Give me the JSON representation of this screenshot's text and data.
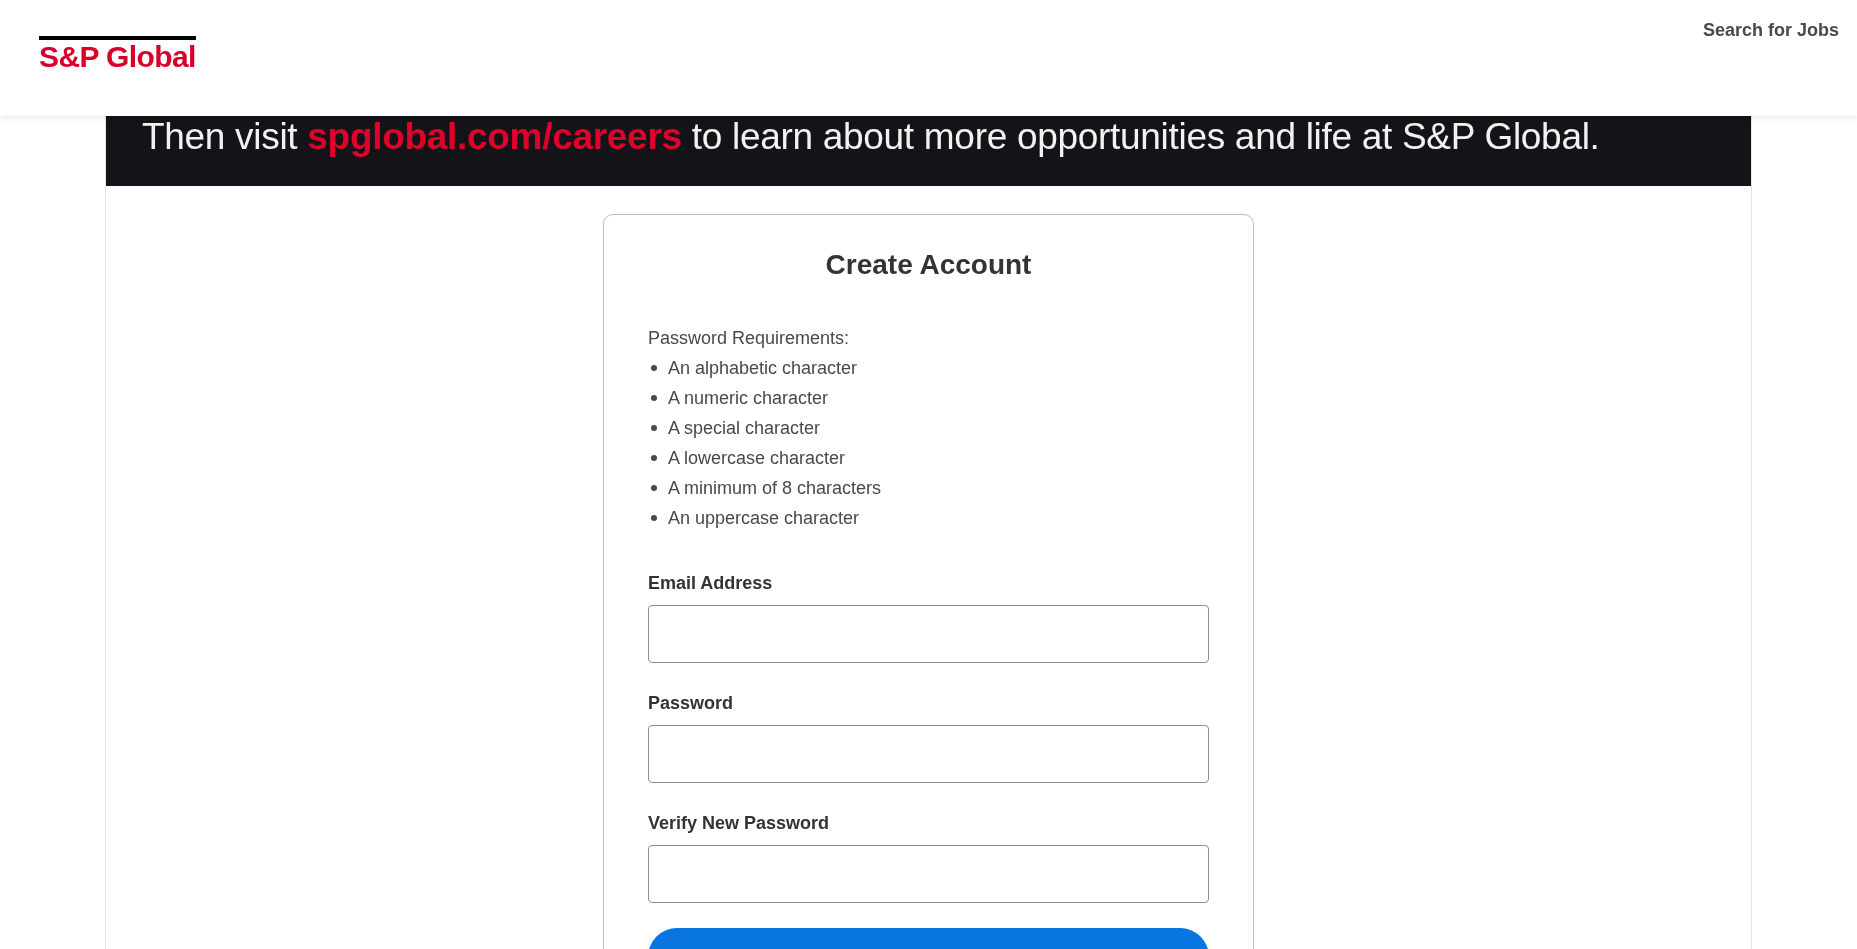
{
  "header": {
    "logo": "S&P Global",
    "nav_link": "Search for Jobs"
  },
  "banner": {
    "text_before": "Then visit",
    "link": "spglobal.com/careers",
    "text_after": "to learn about more opportunities and life at S&P Global."
  },
  "form": {
    "title": "Create Account",
    "requirements_heading": "Password Requirements:",
    "requirements": [
      "An alphabetic character",
      "A numeric character",
      "A special character",
      "A lowercase character",
      "A minimum of 8 characters",
      "An uppercase character"
    ],
    "fields": [
      {
        "label": "Email Address"
      },
      {
        "label": "Password"
      },
      {
        "label": "Verify New Password"
      }
    ]
  }
}
